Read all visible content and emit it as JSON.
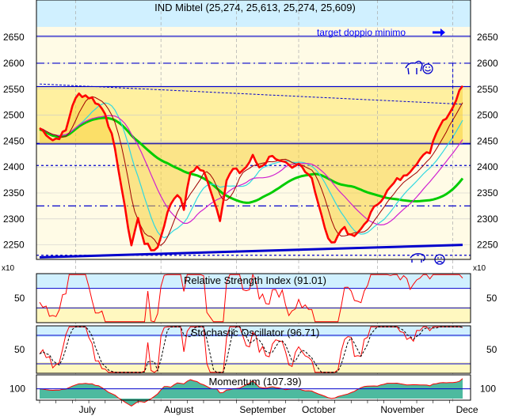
{
  "chart_data": [
    {
      "type": "line",
      "title": "IND Mibtel (25,274, 25,613, 25,274, 25,609)",
      "annotation_target": "target doppio minimo",
      "y_ticks": [
        2650,
        2600,
        2550,
        2500,
        2450,
        2400,
        2350,
        2300,
        2250
      ],
      "ylim": [
        2222,
        2670
      ],
      "scale_label": "x10",
      "x_months": [
        "July",
        "August",
        "September",
        "October",
        "November",
        "Dece"
      ],
      "x_month_index": [
        11,
        37,
        60,
        79,
        103,
        126
      ],
      "n_bars": 130,
      "price_anchors": [
        [
          0,
          2475
        ],
        [
          2,
          2465
        ],
        [
          4,
          2452
        ],
        [
          6,
          2458
        ],
        [
          8,
          2470
        ],
        [
          10,
          2520
        ],
        [
          12,
          2540
        ],
        [
          14,
          2538
        ],
        [
          16,
          2532
        ],
        [
          18,
          2520
        ],
        [
          20,
          2505
        ],
        [
          22,
          2460
        ],
        [
          24,
          2400
        ],
        [
          26,
          2320
        ],
        [
          28,
          2250
        ],
        [
          30,
          2300
        ],
        [
          32,
          2255
        ],
        [
          34,
          2240
        ],
        [
          36,
          2245
        ],
        [
          38,
          2290
        ],
        [
          40,
          2330
        ],
        [
          42,
          2350
        ],
        [
          44,
          2320
        ],
        [
          46,
          2390
        ],
        [
          48,
          2400
        ],
        [
          50,
          2390
        ],
        [
          52,
          2360
        ],
        [
          54,
          2320
        ],
        [
          55,
          2300
        ],
        [
          57,
          2375
        ],
        [
          59,
          2395
        ],
        [
          61,
          2390
        ],
        [
          63,
          2400
        ],
        [
          65,
          2420
        ],
        [
          67,
          2400
        ],
        [
          69,
          2410
        ],
        [
          71,
          2425
        ],
        [
          73,
          2410
        ],
        [
          75,
          2405
        ],
        [
          77,
          2395
        ],
        [
          79,
          2405
        ],
        [
          81,
          2395
        ],
        [
          83,
          2380
        ],
        [
          85,
          2330
        ],
        [
          87,
          2280
        ],
        [
          89,
          2250
        ],
        [
          91,
          2270
        ],
        [
          93,
          2285
        ],
        [
          95,
          2265
        ],
        [
          97,
          2270
        ],
        [
          99,
          2290
        ],
        [
          101,
          2310
        ],
        [
          103,
          2330
        ],
        [
          105,
          2345
        ],
        [
          107,
          2360
        ],
        [
          109,
          2375
        ],
        [
          111,
          2380
        ],
        [
          113,
          2395
        ],
        [
          115,
          2410
        ],
        [
          117,
          2420
        ],
        [
          119,
          2430
        ],
        [
          121,
          2470
        ],
        [
          123,
          2490
        ],
        [
          125,
          2505
        ],
        [
          127,
          2530
        ],
        [
          129,
          2560
        ]
      ],
      "support_line": [
        [
          0,
          2226
        ],
        [
          129,
          2250
        ]
      ],
      "resistance_line": [
        [
          0,
          2560
        ],
        [
          129,
          2521
        ]
      ],
      "horizontal_levels": [
        2652,
        2600,
        2555,
        2445,
        2403,
        2325,
        2230
      ],
      "zone_shade": [
        2445,
        2555
      ]
    },
    {
      "type": "line",
      "title": "Relative Strength Index (91.01)",
      "y_ticks": [
        50
      ],
      "ylim": [
        0,
        100
      ],
      "levels": [
        70,
        30
      ],
      "last_value": 91.01
    },
    {
      "type": "line",
      "title": "Stochastic Oscillator (96.71)",
      "y_ticks": [
        50
      ],
      "ylim": [
        0,
        100
      ],
      "levels": [
        80,
        20
      ],
      "last_value": 96.71
    },
    {
      "type": "area",
      "title": "Momentum (107.39)",
      "y_ticks": [
        100
      ],
      "ylim": [
        93,
        110
      ],
      "last_value": 107.39
    }
  ],
  "colors": {
    "price": "#ff0000",
    "grid": "#7a7aff",
    "axis": "#0000aa",
    "zone": "#fff0a0",
    "fill_gold": "#f8d23a",
    "ma_green": "#00cc00",
    "ma_cyan": "#30d8e0",
    "ma_magenta": "#d020d0",
    "ma_brown": "#a00000",
    "momentum": "#2eae8e",
    "band_top": "#d0f0ff",
    "band_bottom": "#fff8c0"
  },
  "icons": [
    "bull-icon",
    "smiley-icon",
    "bear-icon",
    "frown-icon",
    "arrow-right-icon"
  ]
}
